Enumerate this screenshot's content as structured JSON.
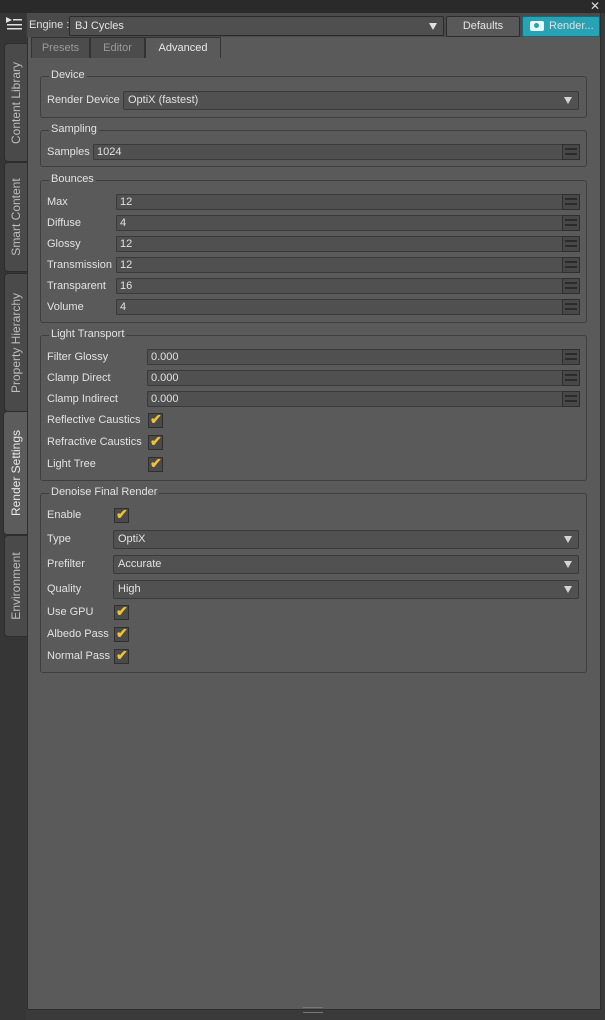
{
  "header": {
    "engine_label": "Engine :",
    "engine_value": "BJ Cycles",
    "defaults_label": "Defaults",
    "render_label": "Render..."
  },
  "side_tabs": [
    "Content Library",
    "Smart Content",
    "Property Hierarchy",
    "Render Settings",
    "Environment"
  ],
  "tabs": [
    "Presets",
    "Editor",
    "Advanced"
  ],
  "device": {
    "title": "Device",
    "render_device_label": "Render Device",
    "render_device_value": "OptiX (fastest)"
  },
  "sampling": {
    "title": "Sampling",
    "samples_label": "Samples",
    "samples_value": "1024"
  },
  "bounces": {
    "title": "Bounces",
    "rows": [
      {
        "label": "Max",
        "value": "12"
      },
      {
        "label": "Diffuse",
        "value": "4"
      },
      {
        "label": "Glossy",
        "value": "12"
      },
      {
        "label": "Transmission",
        "value": "12"
      },
      {
        "label": "Transparent",
        "value": "16"
      },
      {
        "label": "Volume",
        "value": "4"
      }
    ]
  },
  "light_transport": {
    "title": "Light Transport",
    "rows": [
      {
        "label": "Filter Glossy",
        "value": "0.000"
      },
      {
        "label": "Clamp Direct",
        "value": "0.000"
      },
      {
        "label": "Clamp Indirect",
        "value": "0.000"
      }
    ],
    "checks": [
      {
        "label": "Reflective Caustics",
        "checked": true
      },
      {
        "label": "Refractive Caustics",
        "checked": true
      },
      {
        "label": "Light Tree",
        "checked": true
      }
    ]
  },
  "denoise": {
    "title": "Denoise Final Render",
    "enable_label": "Enable",
    "type_label": "Type",
    "type_value": "OptiX",
    "prefilter_label": "Prefilter",
    "prefilter_value": "Accurate",
    "quality_label": "Quality",
    "quality_value": "High",
    "checks": [
      {
        "label": "Use GPU",
        "checked": true
      },
      {
        "label": "Albedo Pass",
        "checked": true
      },
      {
        "label": "Normal Pass",
        "checked": true
      }
    ]
  },
  "check_glyph": "✔",
  "close_glyph": "✕",
  "colors": {
    "accent": "#27a3b3",
    "check": "#f1c232"
  }
}
